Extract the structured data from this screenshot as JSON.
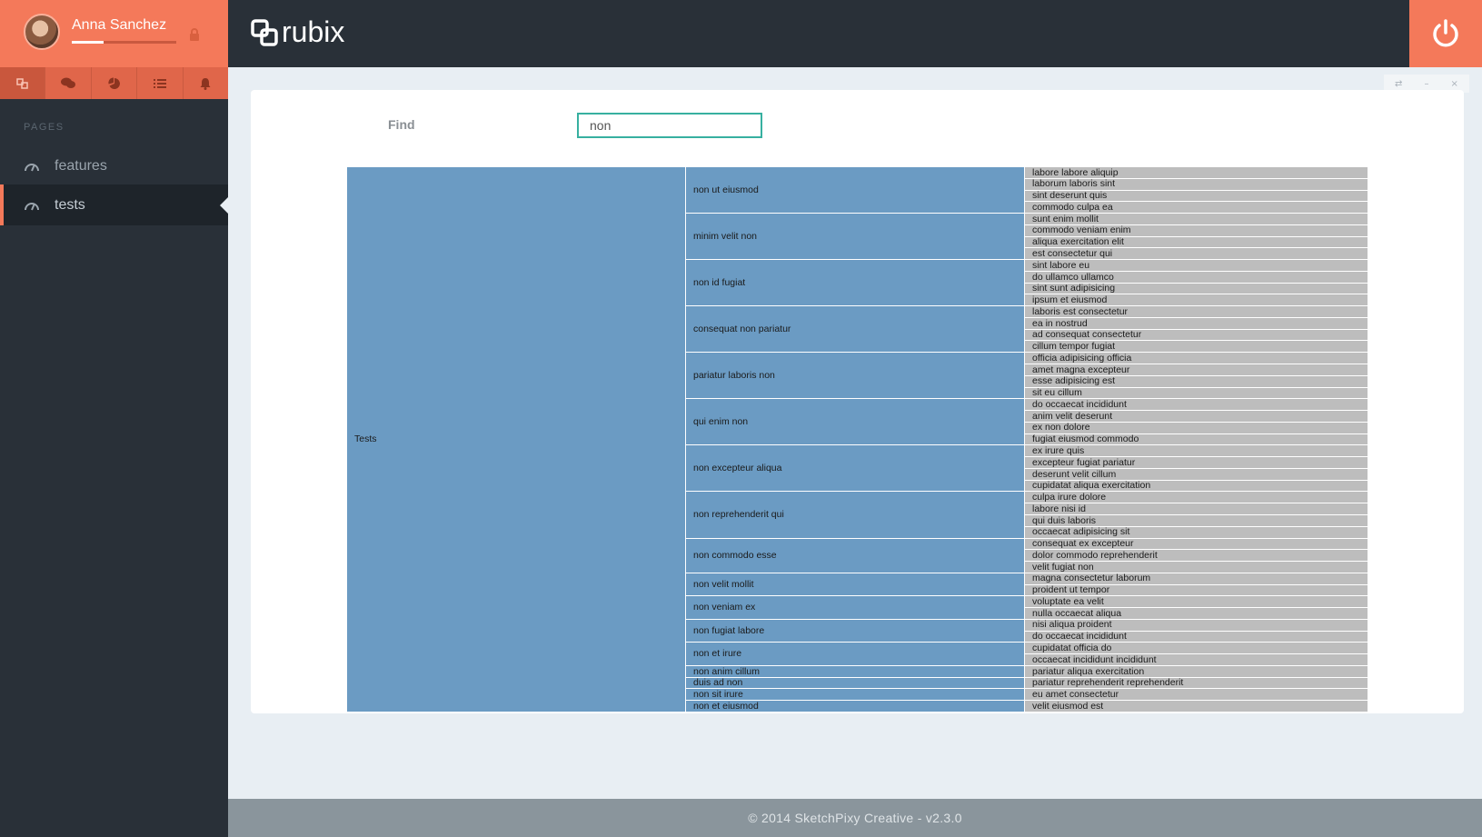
{
  "user": {
    "name": "Anna Sanchez",
    "progress": 0.3
  },
  "sidebar": {
    "icon_tabs": [
      "sitemap-icon",
      "comments-icon",
      "pie-chart-icon",
      "list-icon",
      "bell-icon"
    ],
    "section_label": "PAGES",
    "items": [
      {
        "label": "features",
        "icon": "dashboard-gauge-icon",
        "active": false
      },
      {
        "label": "tests",
        "icon": "dashboard-gauge-icon",
        "active": true
      }
    ]
  },
  "header": {
    "brand": "rubix",
    "power_icon": "power-icon"
  },
  "panel": {
    "controls": [
      "⇄",
      "–",
      "×"
    ]
  },
  "find": {
    "label": "Find",
    "value": "non"
  },
  "tree": {
    "root": {
      "label": "Tests"
    },
    "level2": [
      {
        "label": "non ut eiusmod",
        "leaves": 4
      },
      {
        "label": "minim velit non",
        "leaves": 4
      },
      {
        "label": "non id fugiat",
        "leaves": 4
      },
      {
        "label": "consequat non pariatur",
        "leaves": 4
      },
      {
        "label": "pariatur laboris non",
        "leaves": 4
      },
      {
        "label": "qui enim non",
        "leaves": 4
      },
      {
        "label": "non excepteur aliqua",
        "leaves": 4
      },
      {
        "label": "non reprehenderit qui",
        "leaves": 4
      },
      {
        "label": "non commodo esse",
        "leaves": 3
      },
      {
        "label": "non velit mollit",
        "leaves": 2
      },
      {
        "label": "non veniam ex",
        "leaves": 2
      },
      {
        "label": "non fugiat labore",
        "leaves": 2
      },
      {
        "label": "non et irure",
        "leaves": 2
      },
      {
        "label": "non anim cillum",
        "leaves": 1
      },
      {
        "label": "duis ad non",
        "leaves": 1
      },
      {
        "label": "non sit irure",
        "leaves": 1
      },
      {
        "label": "non et eiusmod",
        "leaves": 1
      }
    ],
    "level3": [
      "labore labore aliquip",
      "laborum laboris sint",
      "sint deserunt quis",
      "commodo culpa ea",
      "sunt enim mollit",
      "commodo veniam enim",
      "aliqua exercitation elit",
      "est consectetur qui",
      "sint labore eu",
      "do ullamco ullamco",
      "sint sunt adipisicing",
      "ipsum et eiusmod",
      "laboris est consectetur",
      "ea in nostrud",
      "ad consequat consectetur",
      "cillum tempor fugiat",
      "officia adipisicing officia",
      "amet magna excepteur",
      "esse adipisicing est",
      "sit eu cillum",
      "do occaecat incididunt",
      "anim velit deserunt",
      "ex non dolore",
      "fugiat eiusmod commodo",
      "ex irure quis",
      "excepteur fugiat pariatur",
      "deserunt velit cillum",
      "cupidatat aliqua exercitation",
      "culpa irure dolore",
      "labore nisi id",
      "qui duis laboris",
      "occaecat adipisicing sit",
      "consequat ex excepteur",
      "dolor commodo reprehenderit",
      "velit fugiat non",
      "magna consectetur laborum",
      "proident ut tempor",
      "voluptate ea velit",
      "nulla occaecat aliqua",
      "nisi aliqua proident",
      "do occaecat incididunt",
      "cupidatat officia do",
      "occaecat incididunt incididunt",
      "pariatur aliqua exercitation",
      "pariatur reprehenderit reprehenderit",
      "eu amet consectetur",
      "velit eiusmod est"
    ]
  },
  "footer": {
    "text": "© 2014 SketchPixy Creative - v2.3.0"
  }
}
